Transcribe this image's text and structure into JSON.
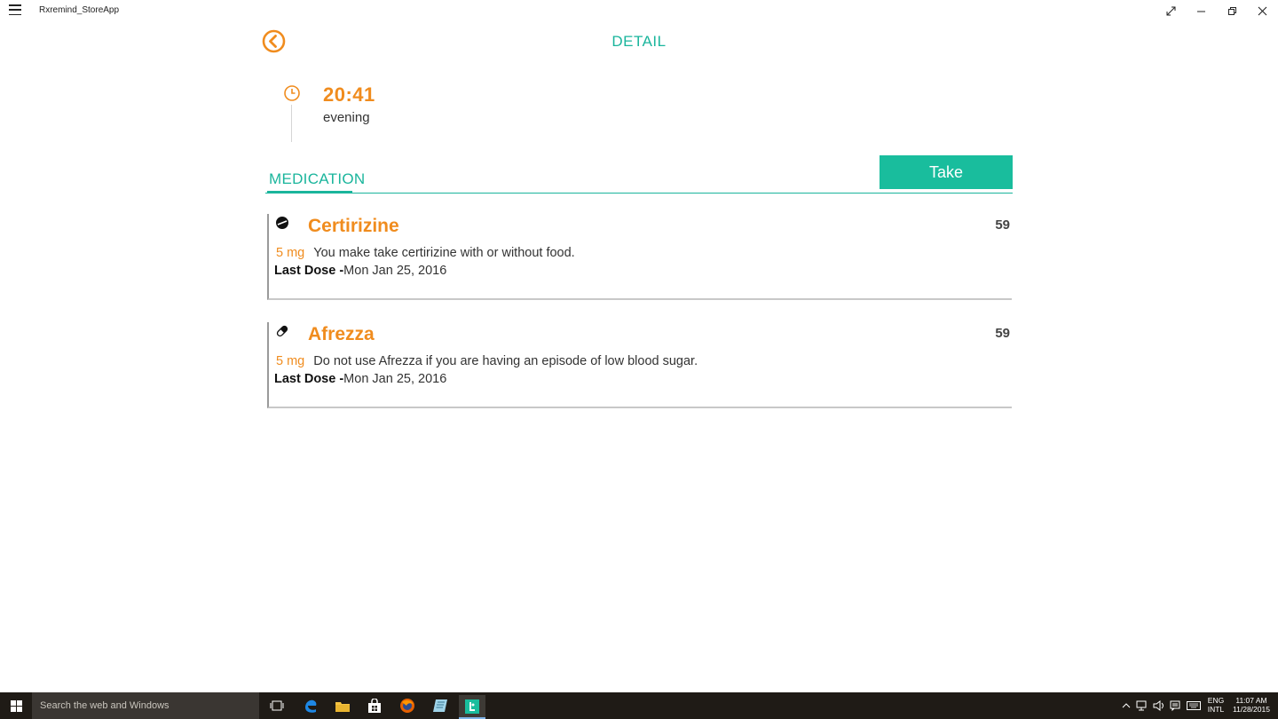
{
  "window": {
    "title": "Rxremind_StoreApp"
  },
  "header": {
    "title": "DETAIL",
    "back_icon": "back-arrow-circle-icon"
  },
  "schedule": {
    "time": "20:41",
    "period": "evening",
    "clock_icon": "clock-icon"
  },
  "section": {
    "tab_label": "MEDICATION",
    "take_label": "Take"
  },
  "medications": [
    {
      "icon": "tablet-icon",
      "name": "Certirizine",
      "count": "59",
      "dose": "5 mg",
      "description": "You make take certirizine with or without food.",
      "last_dose_label": "Last Dose -",
      "last_dose_value": "Mon Jan 25, 2016"
    },
    {
      "icon": "capsule-icon",
      "name": "Afrezza",
      "count": "59",
      "dose": "5 mg",
      "description": "Do not use Afrezza if you are having an episode of low blood sugar.",
      "last_dose_label": "Last Dose -",
      "last_dose_value": "Mon Jan 25, 2016"
    }
  ],
  "taskbar": {
    "search_placeholder": "Search the web and Windows",
    "lang_top": "ENG",
    "lang_bottom": "INTL",
    "clock_time": "11:07 AM",
    "clock_date": "11/28/2015"
  },
  "colors": {
    "accent_teal": "#1ab59c",
    "accent_orange": "#f08c1e",
    "take_button": "#19bd9d"
  }
}
